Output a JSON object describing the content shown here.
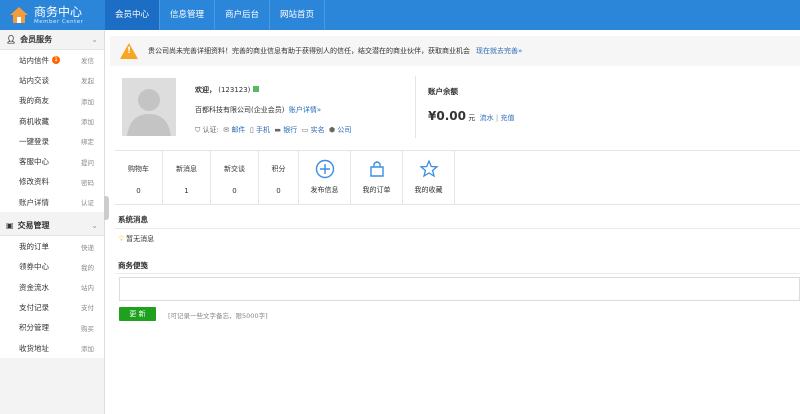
{
  "header": {
    "logo_title": "商务中心",
    "logo_subtitle": "Member Center",
    "tabs": [
      {
        "label": "会员中心",
        "active": true
      },
      {
        "label": "信息管理"
      },
      {
        "label": "商户后台"
      },
      {
        "label": "网站首页"
      }
    ]
  },
  "sidebar": {
    "sections": [
      {
        "title": "会员服务",
        "items": [
          {
            "label": "站内信件",
            "badge": "1",
            "action": "发信"
          },
          {
            "label": "站内交谈",
            "action": "发起"
          },
          {
            "label": "我的商友",
            "action": "添加"
          },
          {
            "label": "商机收藏",
            "action": "添加"
          },
          {
            "label": "一键登录",
            "action": "绑定"
          },
          {
            "label": "客服中心",
            "action": "提问"
          },
          {
            "label": "修改资料",
            "action": "密码"
          },
          {
            "label": "账户详情",
            "action": "认证"
          }
        ]
      },
      {
        "title": "交易管理",
        "items": [
          {
            "label": "我的订单",
            "action": "快递"
          },
          {
            "label": "领券中心",
            "action": "我的"
          },
          {
            "label": "资金流水",
            "action": "站内"
          },
          {
            "label": "支付记录",
            "action": "支付"
          },
          {
            "label": "积分管理",
            "action": "购买"
          },
          {
            "label": "收货地址",
            "action": "添加"
          }
        ]
      }
    ]
  },
  "notice": {
    "text": "贵公司尚未完善详细资料！完善的商业信息有助于获得别人的信任，结交潜在的商业伙伴，获取商业机会",
    "link": "现在就去完善»"
  },
  "profile": {
    "welcome": "欢迎，",
    "user": "(123123)",
    "company": "百都科技有限公司(企业会员)",
    "detail_link": "账户详情»",
    "verify_label": "认证:",
    "verify": [
      "邮件",
      "手机",
      "银行",
      "实名",
      "公司"
    ]
  },
  "balance": {
    "title": "账户余额",
    "amount": "¥0.00",
    "unit": "元",
    "flow": "流水",
    "sep": "|",
    "recharge": "充值"
  },
  "stats": [
    {
      "label": "购物车",
      "value": "0"
    },
    {
      "label": "新消息",
      "value": "1"
    },
    {
      "label": "新交谈",
      "value": "0"
    },
    {
      "label": "积分",
      "value": "0"
    }
  ],
  "shortcuts": [
    {
      "label": "发布信息",
      "icon": "plus-circle"
    },
    {
      "label": "我的订单",
      "icon": "basket"
    },
    {
      "label": "我的收藏",
      "icon": "star"
    }
  ],
  "system": {
    "title": "系统消息",
    "empty": "暂无消息"
  },
  "memo": {
    "title": "商务便笺",
    "button": "更 新",
    "hint": "[可记录一些文字备忘，限5000字]"
  },
  "colors": {
    "primary": "#2b86d9",
    "active_tab": "#1c6ec4",
    "green": "#1ea11e",
    "badge": "#ff6600"
  }
}
